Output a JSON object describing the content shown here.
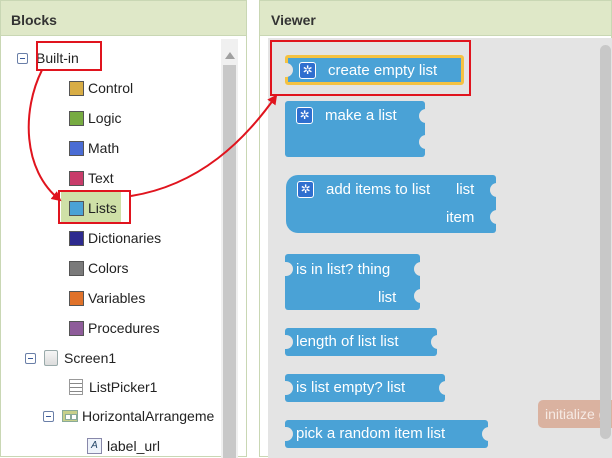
{
  "blocks_panel": {
    "title": "Blocks",
    "root": "Built-in",
    "categories": [
      {
        "label": "Control",
        "color": "#d8ad45"
      },
      {
        "label": "Logic",
        "color": "#77ab41"
      },
      {
        "label": "Math",
        "color": "#4a6cd4"
      },
      {
        "label": "Text",
        "color": "#c83c6a"
      },
      {
        "label": "Lists",
        "color": "#4aa2d6"
      },
      {
        "label": "Dictionaries",
        "color": "#2d2a8f"
      },
      {
        "label": "Colors",
        "color": "#7a7a7a"
      },
      {
        "label": "Variables",
        "color": "#e0722a"
      },
      {
        "label": "Procedures",
        "color": "#8e5c9a"
      }
    ],
    "components": {
      "screen": "Screen1",
      "list_picker": "ListPicker1",
      "arrangement": "HorizontalArrangeme",
      "label": "label_url"
    }
  },
  "viewer": {
    "title": "Viewer",
    "blocks": {
      "create_empty": "create empty list",
      "make_list": "make a list",
      "add_items": "add items to list",
      "add_items_list": "list",
      "add_items_item": "item",
      "is_in_list": "is in list? thing",
      "is_in_list_list": "list",
      "length": "length of list  list",
      "is_empty": "is list empty?  list",
      "pick_random": "pick a random item  list"
    },
    "floating": "initialize g"
  },
  "colors": {
    "list_block": "#4aa2d6",
    "highlight": "#f5c242",
    "annotation": "#e0141e"
  }
}
